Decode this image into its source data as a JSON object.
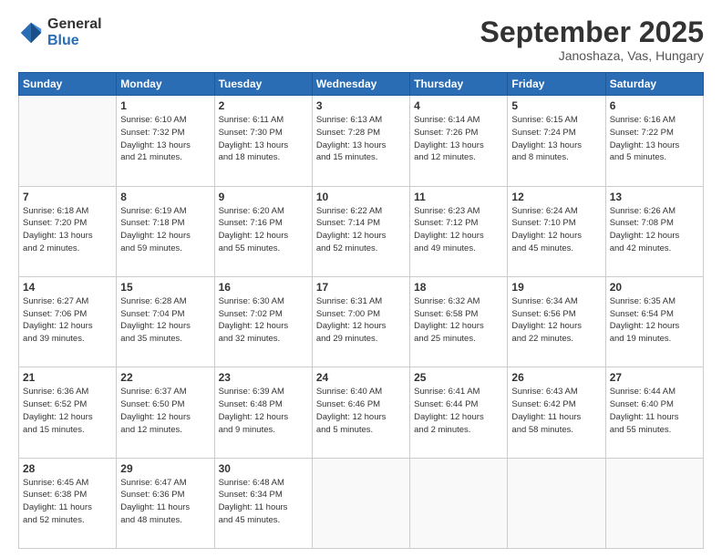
{
  "logo": {
    "general": "General",
    "blue": "Blue"
  },
  "header": {
    "month": "September 2025",
    "location": "Janoshaza, Vas, Hungary"
  },
  "weekdays": [
    "Sunday",
    "Monday",
    "Tuesday",
    "Wednesday",
    "Thursday",
    "Friday",
    "Saturday"
  ],
  "weeks": [
    [
      {
        "day": "",
        "info": ""
      },
      {
        "day": "1",
        "info": "Sunrise: 6:10 AM\nSunset: 7:32 PM\nDaylight: 13 hours\nand 21 minutes."
      },
      {
        "day": "2",
        "info": "Sunrise: 6:11 AM\nSunset: 7:30 PM\nDaylight: 13 hours\nand 18 minutes."
      },
      {
        "day": "3",
        "info": "Sunrise: 6:13 AM\nSunset: 7:28 PM\nDaylight: 13 hours\nand 15 minutes."
      },
      {
        "day": "4",
        "info": "Sunrise: 6:14 AM\nSunset: 7:26 PM\nDaylight: 13 hours\nand 12 minutes."
      },
      {
        "day": "5",
        "info": "Sunrise: 6:15 AM\nSunset: 7:24 PM\nDaylight: 13 hours\nand 8 minutes."
      },
      {
        "day": "6",
        "info": "Sunrise: 6:16 AM\nSunset: 7:22 PM\nDaylight: 13 hours\nand 5 minutes."
      }
    ],
    [
      {
        "day": "7",
        "info": "Sunrise: 6:18 AM\nSunset: 7:20 PM\nDaylight: 13 hours\nand 2 minutes."
      },
      {
        "day": "8",
        "info": "Sunrise: 6:19 AM\nSunset: 7:18 PM\nDaylight: 12 hours\nand 59 minutes."
      },
      {
        "day": "9",
        "info": "Sunrise: 6:20 AM\nSunset: 7:16 PM\nDaylight: 12 hours\nand 55 minutes."
      },
      {
        "day": "10",
        "info": "Sunrise: 6:22 AM\nSunset: 7:14 PM\nDaylight: 12 hours\nand 52 minutes."
      },
      {
        "day": "11",
        "info": "Sunrise: 6:23 AM\nSunset: 7:12 PM\nDaylight: 12 hours\nand 49 minutes."
      },
      {
        "day": "12",
        "info": "Sunrise: 6:24 AM\nSunset: 7:10 PM\nDaylight: 12 hours\nand 45 minutes."
      },
      {
        "day": "13",
        "info": "Sunrise: 6:26 AM\nSunset: 7:08 PM\nDaylight: 12 hours\nand 42 minutes."
      }
    ],
    [
      {
        "day": "14",
        "info": "Sunrise: 6:27 AM\nSunset: 7:06 PM\nDaylight: 12 hours\nand 39 minutes."
      },
      {
        "day": "15",
        "info": "Sunrise: 6:28 AM\nSunset: 7:04 PM\nDaylight: 12 hours\nand 35 minutes."
      },
      {
        "day": "16",
        "info": "Sunrise: 6:30 AM\nSunset: 7:02 PM\nDaylight: 12 hours\nand 32 minutes."
      },
      {
        "day": "17",
        "info": "Sunrise: 6:31 AM\nSunset: 7:00 PM\nDaylight: 12 hours\nand 29 minutes."
      },
      {
        "day": "18",
        "info": "Sunrise: 6:32 AM\nSunset: 6:58 PM\nDaylight: 12 hours\nand 25 minutes."
      },
      {
        "day": "19",
        "info": "Sunrise: 6:34 AM\nSunset: 6:56 PM\nDaylight: 12 hours\nand 22 minutes."
      },
      {
        "day": "20",
        "info": "Sunrise: 6:35 AM\nSunset: 6:54 PM\nDaylight: 12 hours\nand 19 minutes."
      }
    ],
    [
      {
        "day": "21",
        "info": "Sunrise: 6:36 AM\nSunset: 6:52 PM\nDaylight: 12 hours\nand 15 minutes."
      },
      {
        "day": "22",
        "info": "Sunrise: 6:37 AM\nSunset: 6:50 PM\nDaylight: 12 hours\nand 12 minutes."
      },
      {
        "day": "23",
        "info": "Sunrise: 6:39 AM\nSunset: 6:48 PM\nDaylight: 12 hours\nand 9 minutes."
      },
      {
        "day": "24",
        "info": "Sunrise: 6:40 AM\nSunset: 6:46 PM\nDaylight: 12 hours\nand 5 minutes."
      },
      {
        "day": "25",
        "info": "Sunrise: 6:41 AM\nSunset: 6:44 PM\nDaylight: 12 hours\nand 2 minutes."
      },
      {
        "day": "26",
        "info": "Sunrise: 6:43 AM\nSunset: 6:42 PM\nDaylight: 11 hours\nand 58 minutes."
      },
      {
        "day": "27",
        "info": "Sunrise: 6:44 AM\nSunset: 6:40 PM\nDaylight: 11 hours\nand 55 minutes."
      }
    ],
    [
      {
        "day": "28",
        "info": "Sunrise: 6:45 AM\nSunset: 6:38 PM\nDaylight: 11 hours\nand 52 minutes."
      },
      {
        "day": "29",
        "info": "Sunrise: 6:47 AM\nSunset: 6:36 PM\nDaylight: 11 hours\nand 48 minutes."
      },
      {
        "day": "30",
        "info": "Sunrise: 6:48 AM\nSunset: 6:34 PM\nDaylight: 11 hours\nand 45 minutes."
      },
      {
        "day": "",
        "info": ""
      },
      {
        "day": "",
        "info": ""
      },
      {
        "day": "",
        "info": ""
      },
      {
        "day": "",
        "info": ""
      }
    ]
  ]
}
